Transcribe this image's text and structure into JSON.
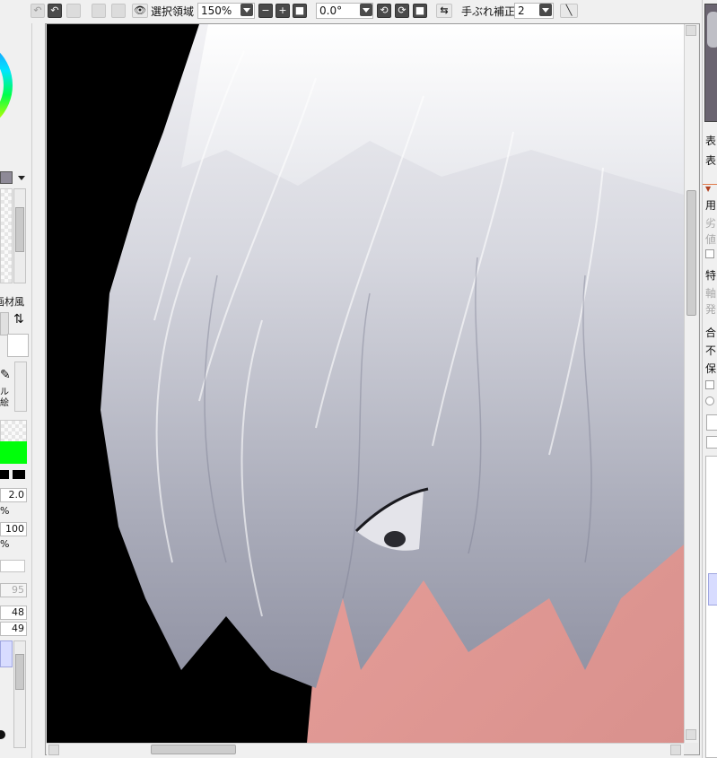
{
  "toolbar": {
    "selection_label": "選択領域",
    "zoom_value": "150%",
    "rotation_value": "0.0°",
    "stabilizer_label": "手ぶれ補正",
    "stabilizer_value": "2"
  },
  "left_panel": {
    "texture_label": "画材風",
    "brush_label_1": "ル",
    "brush_label_2": "絵",
    "size_value": "2.0",
    "percent_1": "%",
    "density_value": "100",
    "percent_2": "%",
    "blur_value": "95",
    "value_a": "48",
    "value_b": "49"
  },
  "right_panel": {
    "labels": [
      "表",
      "表",
      "用",
      "劣",
      "値",
      "特",
      "軸",
      "発",
      "合",
      "不",
      "保"
    ]
  },
  "colors": {
    "accent_green": "#00ff0a",
    "skin": "#e39a95",
    "hair": "#d9dae2",
    "background": "#000000"
  }
}
